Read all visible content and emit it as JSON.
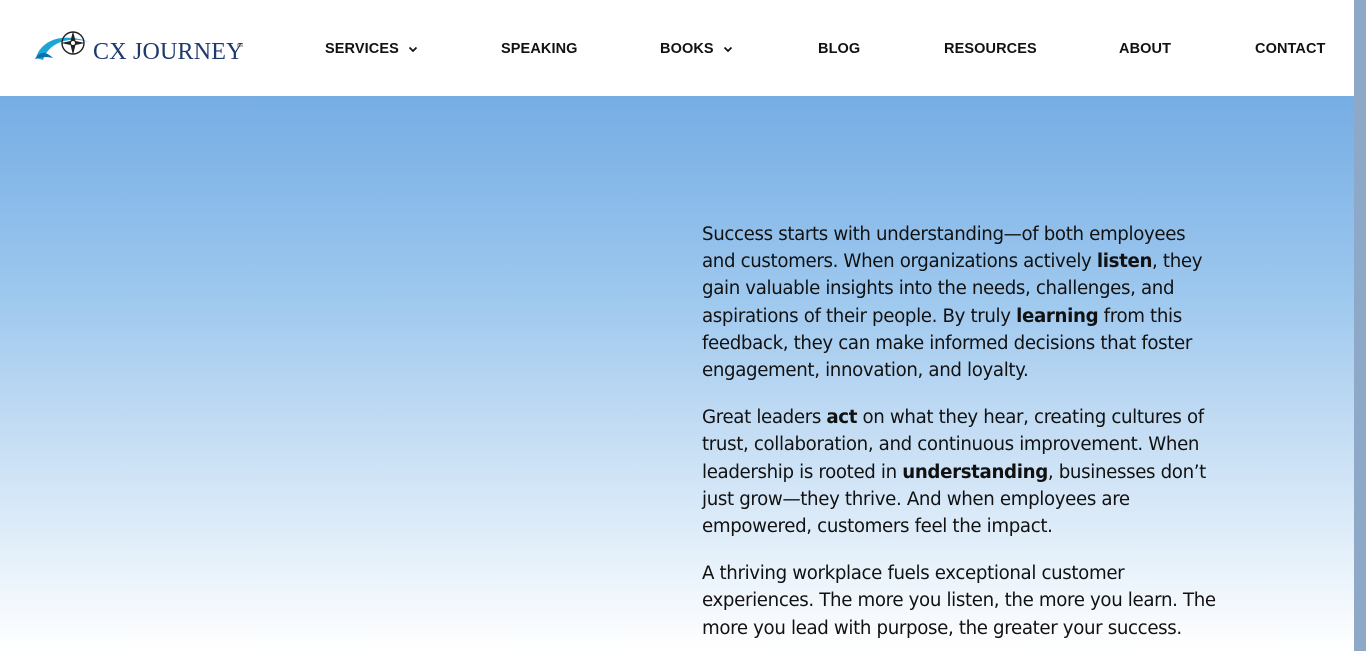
{
  "brand": {
    "name": "CX JOURNEY",
    "trademark": "™",
    "logo_icon": "compass-swoosh-icon",
    "colors": {
      "swoosh": "#1aa7d8",
      "navy": "#1f3a6e"
    }
  },
  "nav": {
    "items": [
      {
        "label": "SERVICES",
        "has_dropdown": true,
        "icon": "chevron-down-icon"
      },
      {
        "label": "SPEAKING",
        "has_dropdown": false
      },
      {
        "label": "BOOKS",
        "has_dropdown": true,
        "icon": "chevron-down-icon"
      },
      {
        "label": "BLOG",
        "has_dropdown": false
      },
      {
        "label": "RESOURCES",
        "has_dropdown": false
      },
      {
        "label": "ABOUT",
        "has_dropdown": false
      },
      {
        "label": "CONTACT",
        "has_dropdown": false
      }
    ]
  },
  "hero": {
    "colors": {
      "top": "#76ade4",
      "bottom": "#ffffff"
    },
    "paragraphs": [
      {
        "parts": [
          "Success starts with understanding—of both employees and customers. When organizations actively ",
          "listen",
          ", they gain valuable insights into the needs, challenges, and aspirations of their people. By truly ",
          "learning",
          " from this feedback, they can make informed decisions that foster engagement, innovation, and loyalty."
        ]
      },
      {
        "parts": [
          "Great leaders ",
          "act",
          " on what they hear, creating cultures of trust, collaboration, and continuous improvement. When leadership is rooted in ",
          "understanding",
          ", businesses don’t just grow—they thrive. And when employees are empowered, customers feel the impact."
        ]
      },
      {
        "parts": [
          "A thriving workplace fuels exceptional customer experiences. The more you listen, the more you learn. The more you lead with purpose, the greater your success."
        ]
      }
    ]
  }
}
